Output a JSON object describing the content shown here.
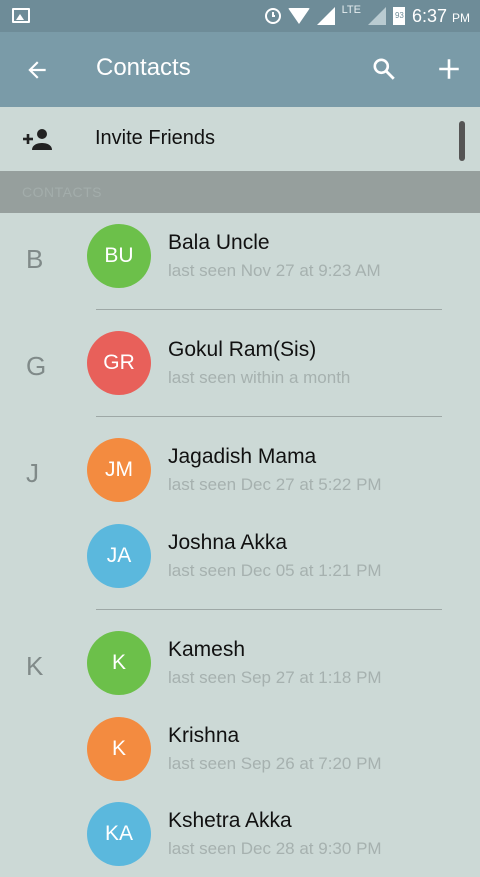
{
  "status_bar": {
    "network": "LTE",
    "battery": "93",
    "time": "6:37",
    "ampm": "PM"
  },
  "app_bar": {
    "title": "Contacts"
  },
  "invite": {
    "label": "Invite Friends"
  },
  "section": {
    "label": "CONTACTS"
  },
  "contacts": [
    {
      "letter": "B",
      "initials": "BU",
      "name": "Bala Uncle",
      "status": "last seen Nov 27 at 9:23 AM",
      "color": "#6cc04a"
    },
    {
      "letter": "G",
      "initials": "GR",
      "name": "Gokul Ram(Sis)",
      "status": "last seen within a month",
      "color": "#e8605a"
    },
    {
      "letter": "J",
      "initials": "JM",
      "name": "Jagadish Mama",
      "status": "last seen Dec 27 at 5:22 PM",
      "color": "#f38b40"
    },
    {
      "letter": "",
      "initials": "JA",
      "name": "Joshna Akka",
      "status": "last seen Dec 05 at 1:21 PM",
      "color": "#5bb8dd"
    },
    {
      "letter": "K",
      "initials": "K",
      "name": "Kamesh",
      "status": "last seen Sep 27 at 1:18 PM",
      "color": "#6cc04a"
    },
    {
      "letter": "",
      "initials": "K",
      "name": "Krishna",
      "status": "last seen Sep 26 at 7:20 PM",
      "color": "#f38b40"
    },
    {
      "letter": "",
      "initials": "KA",
      "name": "Kshetra Akka",
      "status": "last seen Dec 28 at 9:30 PM",
      "color": "#5bb8dd"
    }
  ]
}
